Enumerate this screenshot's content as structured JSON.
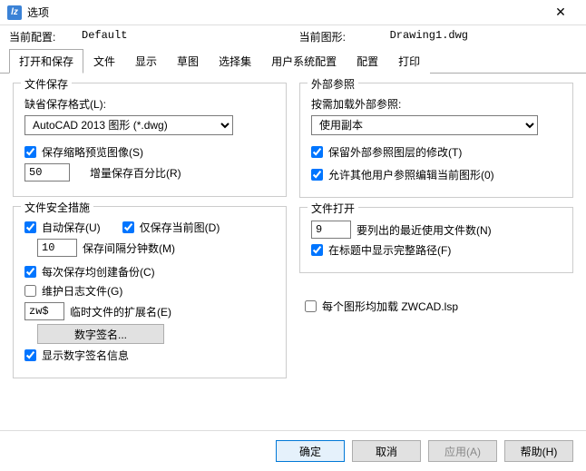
{
  "window": {
    "title": "选项"
  },
  "profile": {
    "current_profile_label": "当前配置:",
    "current_profile_value": "Default",
    "current_drawing_label": "当前图形:",
    "current_drawing_value": "Drawing1.dwg"
  },
  "tabs": [
    "打开和保存",
    "文件",
    "显示",
    "草图",
    "选择集",
    "用户系统配置",
    "配置",
    "打印"
  ],
  "file_save": {
    "group_title": "文件保存",
    "default_format_label": "缺省保存格式(L):",
    "default_format_value": "AutoCAD 2013 图形 (*.dwg)",
    "save_thumbnail_label": "保存缩略预览图像(S)",
    "save_thumbnail_checked": true,
    "incremental_percent_value": "50",
    "incremental_percent_label": "增量保存百分比(R)"
  },
  "file_safety": {
    "group_title": "文件安全措施",
    "autosave_label": "自动保存(U)",
    "autosave_checked": true,
    "only_current_label": "仅保存当前图(D)",
    "only_current_checked": true,
    "interval_value": "10",
    "interval_label": "保存间隔分钟数(M)",
    "backup_each_save_label": "每次保存均创建备份(C)",
    "backup_each_save_checked": true,
    "maintain_log_label": "维护日志文件(G)",
    "maintain_log_checked": false,
    "temp_ext_value": "zw$",
    "temp_ext_label": "临时文件的扩展名(E)",
    "digital_signature_button": "数字签名...",
    "show_digital_info_label": "显示数字签名信息",
    "show_digital_info_checked": true
  },
  "xref": {
    "group_title": "外部参照",
    "demand_load_label": "按需加载外部参照:",
    "demand_load_value": "使用副本",
    "retain_changes_label": "保留外部参照图层的修改(T)",
    "retain_changes_checked": true,
    "allow_others_label": "允许其他用户参照编辑当前图形(0)",
    "allow_others_checked": true
  },
  "file_open": {
    "group_title": "文件打开",
    "recent_count_value": "9",
    "recent_count_label": "要列出的最近使用文件数(N)",
    "full_path_title_label": "在标题中显示完整路径(F)",
    "full_path_title_checked": true,
    "load_lisp_label": "每个图形均加载 ZWCAD.lsp",
    "load_lisp_checked": false
  },
  "footer": {
    "ok": "确定",
    "cancel": "取消",
    "apply": "应用(A)",
    "help": "帮助(H)"
  }
}
